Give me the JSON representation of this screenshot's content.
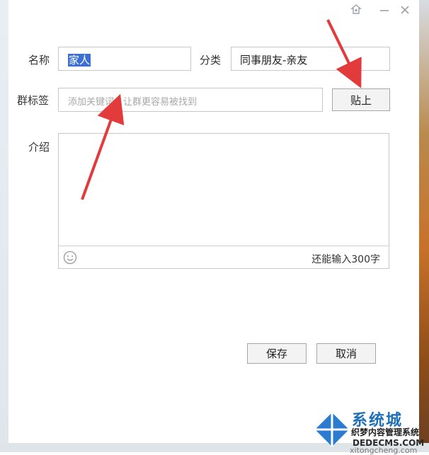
{
  "window": {
    "pin_icon": "pin-icon",
    "minimize_icon": "minimize-icon",
    "close_icon": "close-icon"
  },
  "form": {
    "name_label": "名称",
    "name_value": "家人",
    "category_label": "分类",
    "category_value": "同事朋友-亲友",
    "tags_label": "群标签",
    "tags_placeholder": "添加关键词，让群更容易被找到",
    "paste_button": "贴上",
    "intro_label": "介绍",
    "intro_value": "",
    "char_counter": "还能输入300字",
    "emoji_icon": "smiley-icon"
  },
  "actions": {
    "save_label": "保存",
    "cancel_label": "取消"
  },
  "annotations": {
    "arrow_color": "#e33b3b"
  },
  "watermark": {
    "main": "系统城",
    "sub": "织梦内容管理系统",
    "url": "DEDECMS.COM",
    "site": "xitongcheng.com"
  }
}
